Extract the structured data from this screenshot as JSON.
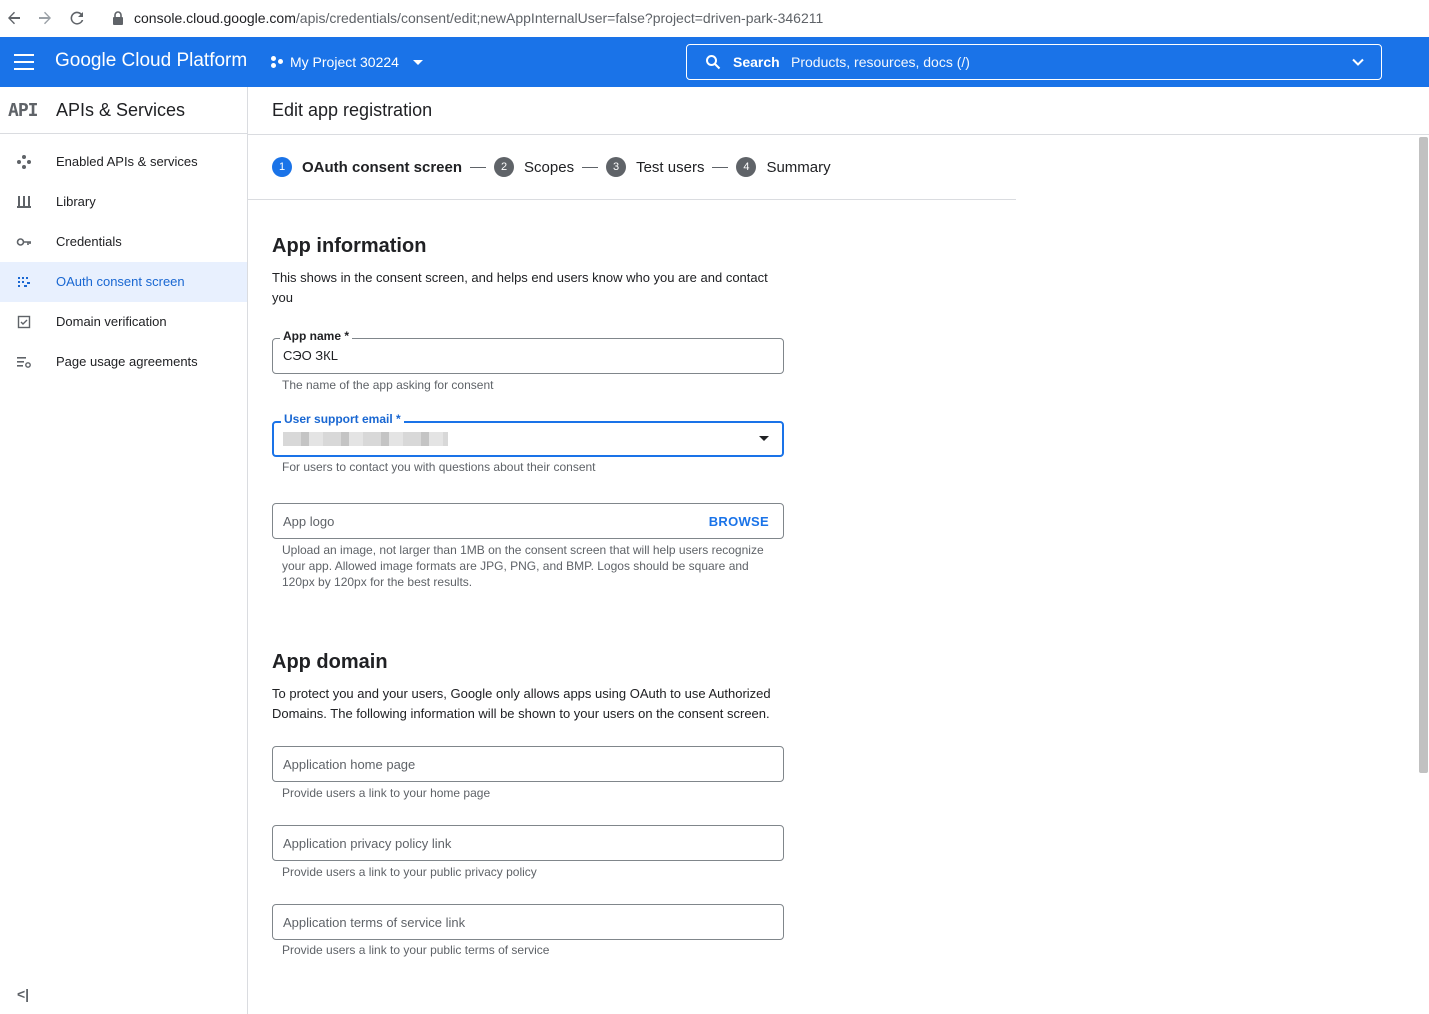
{
  "browser": {
    "url_host": "console.cloud.google.com",
    "url_path": "/apis/credentials/consent/edit;newAppInternalUser=false?project=driven-park-346211"
  },
  "topbar": {
    "brand": "Google Cloud Platform",
    "project": "My Project 30224",
    "search_label": "Search",
    "search_placeholder": "Products, resources, docs (/)"
  },
  "sidebar": {
    "logo": "API",
    "title": "APIs & Services",
    "items": [
      {
        "label": "Enabled APIs & services",
        "icon": "enabled-apis-icon"
      },
      {
        "label": "Library",
        "icon": "library-icon"
      },
      {
        "label": "Credentials",
        "icon": "key-icon"
      },
      {
        "label": "OAuth consent screen",
        "icon": "consent-icon",
        "active": true
      },
      {
        "label": "Domain verification",
        "icon": "checkbox-icon"
      },
      {
        "label": "Page usage agreements",
        "icon": "settings-list-icon"
      }
    ],
    "collapse": "<|"
  },
  "main": {
    "title": "Edit app registration",
    "steps": [
      {
        "num": "1",
        "label": "OAuth consent screen",
        "active": true
      },
      {
        "num": "2",
        "label": "Scopes"
      },
      {
        "num": "3",
        "label": "Test users"
      },
      {
        "num": "4",
        "label": "Summary"
      }
    ],
    "app_info": {
      "heading": "App information",
      "desc": "This shows in the consent screen, and helps end users know who you are and contact you",
      "app_name_label": "App name *",
      "app_name_value": "СЭО ЗКL",
      "app_name_hint": "The name of the app asking for consent",
      "support_email_label": "User support email *",
      "support_email_hint": "For users to contact you with questions about their consent",
      "logo_placeholder": "App logo",
      "browse": "BROWSE",
      "logo_hint": "Upload an image, not larger than 1MB on the consent screen that will help users recognize your app. Allowed image formats are JPG, PNG, and BMP. Logos should be square and 120px by 120px for the best results."
    },
    "app_domain": {
      "heading": "App domain",
      "desc": "To protect you and your users, Google only allows apps using OAuth to use Authorized Domains. The following information will be shown to your users on the consent screen.",
      "home_placeholder": "Application home page",
      "home_hint": "Provide users a link to your home page",
      "privacy_placeholder": "Application privacy policy link",
      "privacy_hint": "Provide users a link to your public privacy policy",
      "tos_placeholder": "Application terms of service link",
      "tos_hint": "Provide users a link to your public terms of service"
    }
  },
  "colors": {
    "brand_blue": "#1a73e8",
    "active_bg": "#e8f0fe",
    "active_text": "#1967d2"
  }
}
